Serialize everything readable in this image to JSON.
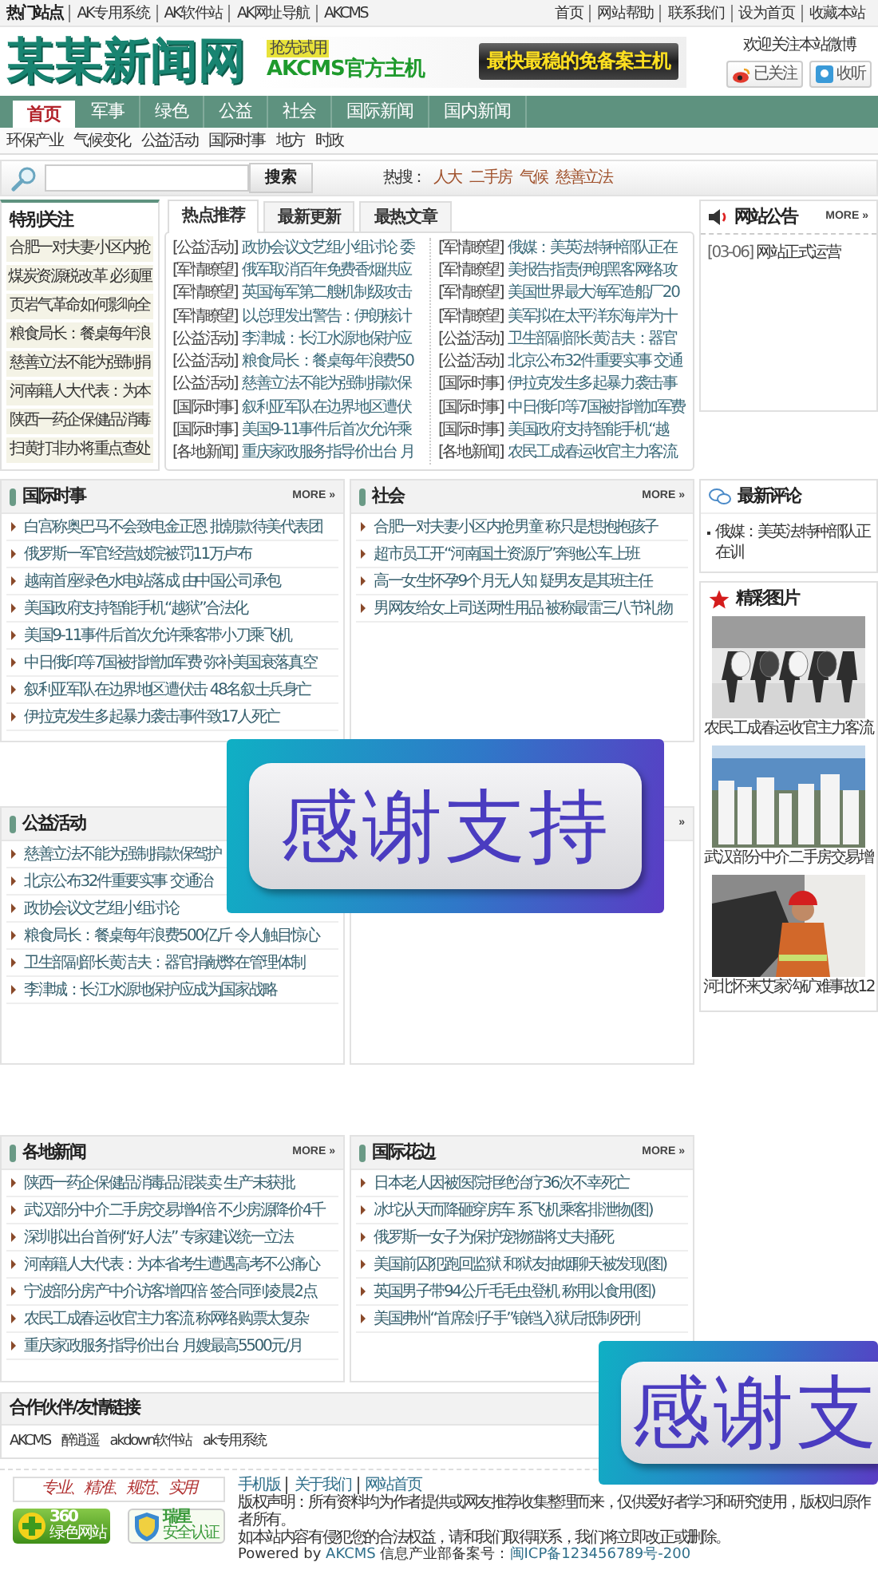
{
  "top_bar": {
    "label": "热门站点",
    "left_links": [
      "AK专用系统",
      "AK软件站",
      "AK网址导航",
      "AKCMS"
    ],
    "right_links": [
      "首页",
      "网站帮助",
      "联系我们",
      "设为首页",
      "收藏本站"
    ]
  },
  "header": {
    "logo": "某某新闻网",
    "banner": {
      "badge": "抢先试用",
      "title": "AKCMS官方主机",
      "slogan": "最快最稳的免备案主机"
    },
    "weibo": {
      "caption": "欢迎关注本站微博",
      "buttons": [
        {
          "kind": "weibo",
          "label": "已关注"
        },
        {
          "kind": "listen",
          "label": "收听"
        }
      ]
    }
  },
  "nav": {
    "tabs": [
      {
        "label": "首页",
        "selected": true
      },
      {
        "label": "军事",
        "selected": false
      },
      {
        "label": "绿色",
        "selected": false
      },
      {
        "label": "公益",
        "selected": false
      },
      {
        "label": "社会",
        "selected": false
      },
      {
        "label": "国际新闻",
        "selected": false
      },
      {
        "label": "国内新闻",
        "selected": false
      }
    ],
    "sub_links": [
      "环保产业",
      "气候变化",
      "公益活动",
      "国际时事",
      "地方",
      "时政"
    ]
  },
  "search": {
    "button": "搜索",
    "hot_label": "热搜：",
    "hot_words": [
      "人大",
      "二手房",
      "气候",
      "慈善立法"
    ]
  },
  "featured": {
    "title": "特别关注",
    "items": [
      "合肥一对夫妻小区内抢",
      "煤炭资源税改革 必须厘",
      "页岩气革命如何影响全",
      "粮食局长：餐桌每年浪",
      "慈善立法不能为强制捐",
      "河南籍人大代表：为本",
      "陕西一药企保健品消毒",
      "扫黄打非办将重点查处"
    ]
  },
  "recommend": {
    "tabs": [
      {
        "label": "热点推荐",
        "selected": true
      },
      {
        "label": "最新更新",
        "selected": false
      },
      {
        "label": "最热文章",
        "selected": false
      }
    ],
    "columns": [
      [
        {
          "category": "[公益活动]",
          "title": "政协会议文艺组小组讨论 委"
        },
        {
          "category": "[军情瞭望]",
          "title": "俄军取消百年免费香烟供应"
        },
        {
          "category": "[军情瞭望]",
          "title": "英国海军第二艘机制级攻击"
        },
        {
          "category": "[军情瞭望]",
          "title": "以总理发出警告：伊朗核计"
        },
        {
          "category": "[公益活动]",
          "title": "李津城：长江水源地保护应"
        },
        {
          "category": "[公益活动]",
          "title": "粮食局长：餐桌每年浪费50"
        },
        {
          "category": "[公益活动]",
          "title": "慈善立法不能为强制捐款保"
        },
        {
          "category": "[国际时事]",
          "title": "叙利亚军队在边界地区遭伏"
        },
        {
          "category": "[国际时事]",
          "title": "美国9-11事件后首次允许乘"
        },
        {
          "category": "[各地新闻]",
          "title": "重庆家政服务指导价出台 月"
        }
      ],
      [
        {
          "category": "[军情瞭望]",
          "title": "俄媒：美英法特种部队正在"
        },
        {
          "category": "[军情瞭望]",
          "title": "美报告指责伊朗黑客网络攻"
        },
        {
          "category": "[军情瞭望]",
          "title": "美国世界最大海军造船厂20"
        },
        {
          "category": "[军情瞭望]",
          "title": "美军拟在太平洋东海岸为十"
        },
        {
          "category": "[公益活动]",
          "title": "卫生部副部长黄洁夫：器官"
        },
        {
          "category": "[公益活动]",
          "title": "北京公布32件重要实事 交通"
        },
        {
          "category": "[国际时事]",
          "title": "伊拉克发生多起暴力袭击事"
        },
        {
          "category": "[国际时事]",
          "title": "中日俄印等7国被指增加军费"
        },
        {
          "category": "[国际时事]",
          "title": "美国政府支持智能手机“越"
        },
        {
          "category": "[各地新闻]",
          "title": "农民工成春运收官主力客流"
        }
      ]
    ]
  },
  "notice": {
    "title": "网站公告",
    "more": "MORE »",
    "items": [
      {
        "date": "[03-06]",
        "title": "网站正式运营"
      }
    ]
  },
  "sections": [
    {
      "title": "国际时事",
      "more": "MORE »",
      "items": [
        "白宫称奥巴马不会致电金正恩 批朝款待美代表团",
        "俄罗斯一军官经营妓院被罚11万卢布",
        "越南首座绿色水电站落成 由中国公司承包",
        "美国政府支持智能手机“越狱”合法化",
        "美国9-11事件后首次允许乘客带小刀乘飞机",
        "中日俄印等7国被指增加军费 弥补美国衰落真空",
        "叙利亚军队在边界地区遭伏击 48名叙士兵身亡",
        "伊拉克发生多起暴力袭击事件致17人死亡"
      ]
    },
    {
      "title": "社会",
      "more": "MORE »",
      "items": [
        "合肥一对夫妻小区内抢男童 称只是想抱抱孩子",
        "超市员工开“河南国土资源厅”奔驰公车上班",
        "高一女生怀孕9个月无人知 疑男友是其班主任",
        "男网友给女上司送两性用品 被称最雷三八节礼物"
      ]
    },
    {
      "title": "公益活动",
      "items": [
        "慈善立法不能为强制捐款保驾护",
        "北京公布32件重要实事 交通治",
        "政协会议文艺组小组讨论",
        "粮食局长：餐桌每年浪费500亿斤 令人触目惊心",
        "卫生部副部长黄洁夫：器官捐献弊在管理体制",
        "李津城：长江水源地保护应成为国家战略"
      ]
    },
    {
      "more": "»"
    },
    {
      "title": "各地新闻",
      "more": "MORE »",
      "items": [
        "陕西一药企保健品消毒品混装卖 生产未获批",
        "武汉部分中介二手房交易增4倍 不少房源降价4千",
        "深圳拟出台首例“好人法” 专家建议统一立法",
        "河南籍人大代表：为本省考生遭遇高考不公痛心",
        "宁波部分房产中介访客增四倍 签合同到凌晨2点",
        "农民工成春运收官主力客流 称网络购票太复杂",
        "重庆家政服务指导价出台 月嫂最高5500元/月"
      ]
    },
    {
      "title": "国际花边",
      "more": "MORE »",
      "items": [
        "日本老人因被医院拒绝治疗36次不幸死亡",
        "冰坨从天而降砸穿房车 系飞机乘客排泄物(图)",
        "俄罗斯一女子为保护宠物猫将丈夫捅死",
        "美国前囚犯跑回监狱 和狱友抽烟聊天被发现(图)",
        "英国男子带94公斤毛毛虫登机 称用以食用(图)",
        "美国弗州“首席刽子手”锒铛入狱后抵制死刑"
      ]
    }
  ],
  "comments": {
    "title": "最新评论",
    "items": [
      "俄媒：美英法特种部队正在训"
    ]
  },
  "pictures": {
    "title": "精彩图片",
    "items": [
      {
        "kind": "picture",
        "caption": "农民工成春运收官主力客流"
      },
      {
        "kind": "picture",
        "caption": "武汉部分中介二手房交易增"
      },
      {
        "kind": "picture",
        "caption": "河北怀来艾家沟矿难事故12"
      }
    ]
  },
  "partners": {
    "title": "合作伙伴/友情链接",
    "links": [
      "AKCMS",
      "醉逍遥",
      "akdown软件站",
      "ak专用系统"
    ]
  },
  "footer": {
    "slogan": "专业、精准、规范、实用",
    "badges": [
      {
        "kind": "plus",
        "title": "360",
        "subtitle": "绿色网站"
      },
      {
        "kind": "shield",
        "title": "瑞星",
        "subtitle": "安全认证"
      }
    ],
    "links": [
      "手机版",
      "关于我们",
      "网站首页"
    ],
    "copyright": "版权声明：所有资料均为作者提供或网友推荐收集整理而来，仅供爱好者学习和研究使用，版权归原作者所有。",
    "notice": "如本站内容有侵犯您的合法权益，请和我们取得联系，我们将立即改正或删除。",
    "powered": {
      "prefix": "Powered by",
      "brand": "AKCMS",
      "record_label": "信息产业部备案号：",
      "record": "闽ICP备123456789号-200"
    }
  },
  "float_ads": [
    {
      "text": "感谢支持"
    },
    {
      "text": "感谢支"
    }
  ]
}
